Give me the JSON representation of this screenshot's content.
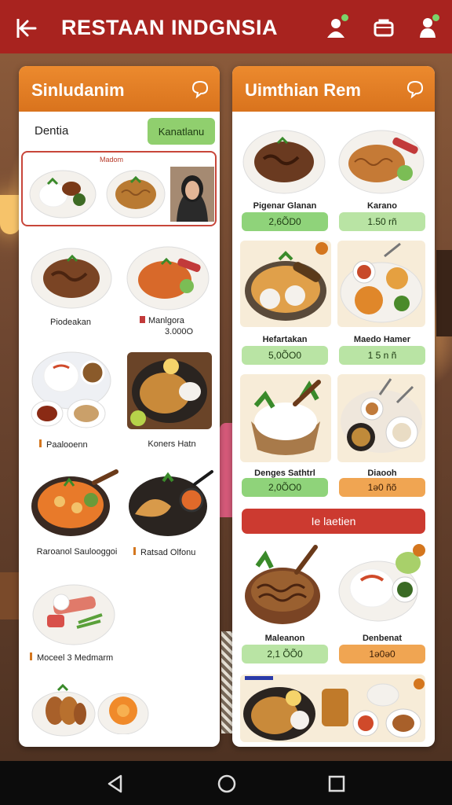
{
  "app": {
    "title": "RESTAAN INDGNSIA"
  },
  "colors": {
    "topbar": "#a8231f",
    "panel_header": "#e07f24",
    "accent_green": "#8fd37a",
    "accent_orange": "#f0a552",
    "banner_red": "#cc3a30"
  },
  "left_panel": {
    "title": "Sinludanim",
    "filter_label": "Dentia",
    "filter_button": "Kanatlanu",
    "featured_label": "Madom",
    "items": [
      {
        "label": "Piodeakan",
        "price": ""
      },
      {
        "label": "Manlgora",
        "price": "3.000O"
      },
      {
        "label": "Paalooenn",
        "price": ""
      },
      {
        "label": "Koners Hatn",
        "price": ""
      },
      {
        "label": "Raroanol Saulooggoi",
        "price": ""
      },
      {
        "label": "Ratsad Olfonu",
        "price": ""
      },
      {
        "label": "Moceel 3 Medmarm",
        "price": ""
      }
    ]
  },
  "right_panel": {
    "title": "Uimthian Rem",
    "banner": "Ie laetien",
    "items": [
      {
        "label": "Pigenar Glanan",
        "price": "2,6ÕD0"
      },
      {
        "label": "Karano",
        "price": "1.50 rñ"
      },
      {
        "label": "Hefartakan",
        "price": "5,0ÕO0"
      },
      {
        "label": "Maedo Hamer",
        "price": "1 5 n ñ"
      },
      {
        "label": "Denges Sathtrl",
        "price": "2,0ÕO0"
      },
      {
        "label": "Diaooh",
        "price": "1ə0 ñõ"
      },
      {
        "label": "Maleanon",
        "price": "2,1 ÕÕ0"
      },
      {
        "label": "Denbenat",
        "price": "1ə0ə0"
      }
    ]
  },
  "icons": {
    "back": "back-arrow-icon",
    "profile": "person-add-icon",
    "cart": "bag-icon",
    "user": "user-icon",
    "head_left": "chat-bubble-icon",
    "head_right": "chat-bubble-icon"
  }
}
